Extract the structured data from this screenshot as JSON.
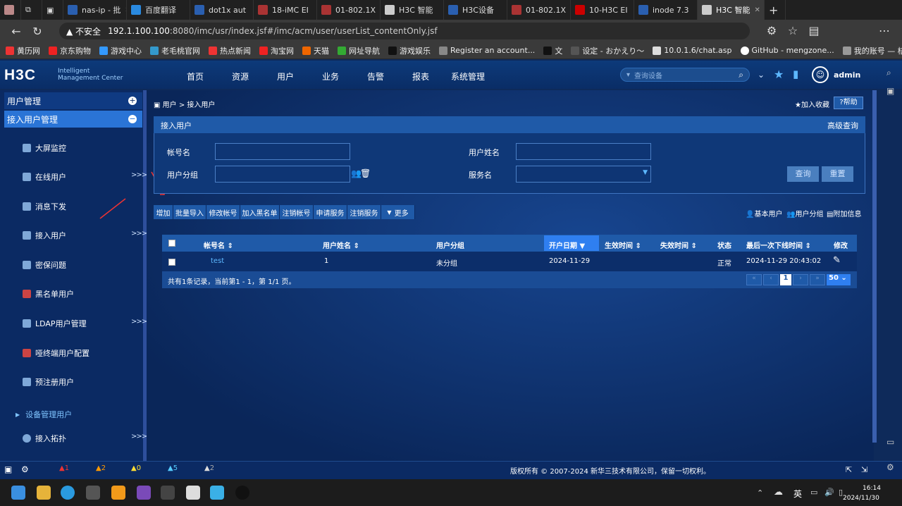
{
  "browser": {
    "tabs": [
      "nas-ip - 批",
      "百度翻译",
      "dot1x aut",
      "18-iMC EI",
      "01-802.1X",
      "H3C 智能",
      "H3C设备",
      "01-802.1X",
      "10-H3C EI",
      "inode 7.3",
      "H3C 智能"
    ],
    "address_warning": "不安全",
    "address_host": "192.1.100.100",
    "address_rest": ":8080/imc/usr/index.jsf#/imc/acm/user/userList_contentOnly.jsf",
    "bookmarks": [
      "黄历网",
      "京东购物",
      "游戏中心",
      "老毛桃官网",
      "热点新闻",
      "淘宝网",
      "天猫",
      "网址导航",
      "游戏娱乐",
      "Register an account...",
      "文",
      "设定 - おかえり～",
      "10.0.1.6/chat.asp",
      "GitHub - mengzone...",
      "我的账号 — 桔子云"
    ]
  },
  "app": {
    "logo": "H3C",
    "logo_sub1": "Intelligent",
    "logo_sub2": "Management Center",
    "nav": [
      "首页",
      "资源",
      "用户",
      "业务",
      "告警",
      "报表",
      "系统管理"
    ],
    "search_placeholder": "查询设备",
    "user": "admin"
  },
  "sidebar": {
    "section": "用户管理",
    "subsection": "接入用户管理",
    "items": [
      "大屏监控",
      "在线用户",
      "消息下发",
      "接入用户",
      "密保问题",
      "黑名单用户",
      "LDAP用户管理",
      "哑终端用户配置",
      "预注册用户"
    ],
    "device_mgmt": "设备管理用户",
    "topo": "接入拓扑"
  },
  "content": {
    "breadcrumb": "用户 > 接入用户",
    "favorite": "加入收藏",
    "help": "帮助",
    "panel_title": "接入用户",
    "advanced": "高级查询",
    "labels": {
      "account": "帐号名",
      "username": "用户姓名",
      "group": "用户分组",
      "service": "服务名"
    },
    "query": "查询",
    "reset": "重置",
    "actions": [
      "增加",
      "批量导入",
      "修改帐号",
      "加入黑名单",
      "注销帐号",
      "申请服务",
      "注销服务",
      "更多"
    ],
    "views": [
      "基本用户",
      "用户分组",
      "附加信息"
    ],
    "columns": [
      "帐号名",
      "用户姓名",
      "用户分组",
      "开户日期",
      "生效时间",
      "失效时间",
      "状态",
      "最后一次下线时间",
      "修改"
    ],
    "row": {
      "account": "test",
      "name": "1",
      "group": "未分组",
      "open_date": "2024-11-29",
      "status": "正常",
      "last_offline": "2024-11-29 20:43:02"
    },
    "summary": "共有1条记录，当前第1 - 1，第 1/1 页。",
    "page": "1",
    "page_size": "50"
  },
  "footer": {
    "alerts": [
      "1",
      "2",
      "0",
      "5",
      "2"
    ],
    "copyright": "版权所有 © 2007-2024 新华三技术有限公司，保留一切权利。"
  },
  "taskbar": {
    "ime": "英",
    "time": "16:14",
    "date": "2024/11/30"
  },
  "colors": {
    "header": "#0d3a7a",
    "accent": "#1f5aa8",
    "active_col": "#2f7ff0"
  }
}
